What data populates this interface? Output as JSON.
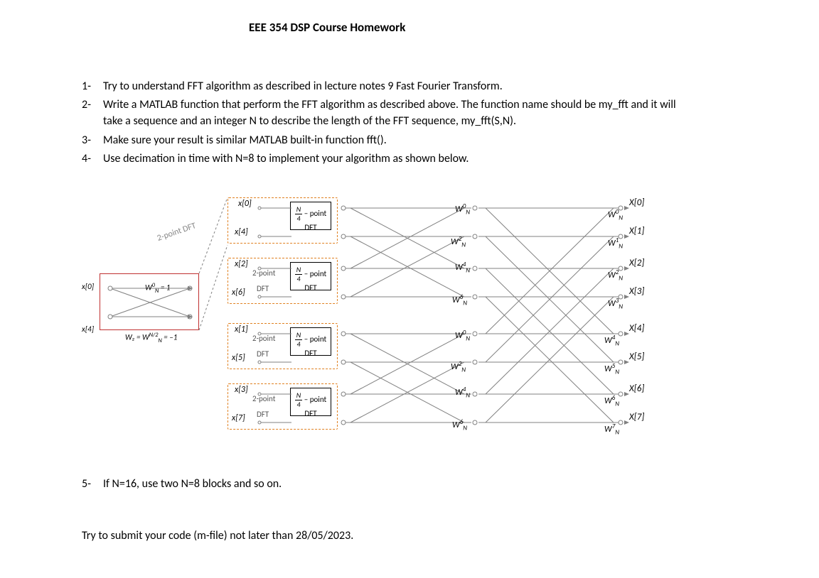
{
  "title": "EEE 354 DSP Course Homework",
  "items": {
    "n1": "1-",
    "t1": "Try to understand FFT algorithm as described in lecture notes 9 Fast Fourier Transform.",
    "n2": "2-",
    "t2": "Write a MATLAB function that perform the FFT algorithm as described above. The function name should be my_fft and it will take a sequence and an integer N to describe the length of the FFT sequence, my_fft(S,N).",
    "n3": "3-",
    "t3": "Make sure your result is similar MATLAB built-in function fft().",
    "n4": "4-",
    "t4": "Use decimation in time with N=8 to implement your algorithm as shown below.",
    "n5": "5-",
    "t5": "If N=16, use two N=8 blocks and so on."
  },
  "footer": "Try to submit your code (m-file) not later than 28/05/2023.",
  "diagram": {
    "zoom_label": "2-point DFT",
    "npoint_top": "– point",
    "npoint_bot": "DFT",
    "grp2pt": "2-point",
    "grpDFT": "DFT",
    "inputs": {
      "x0": "x[0]",
      "x4": "x[4]",
      "x2": "x[2]",
      "x6": "x[6]",
      "x1": "x[1]",
      "x5": "x[5]",
      "x3": "x[3]",
      "x7": "x[7]"
    },
    "zoom_in": {
      "a": "x[0]",
      "b": "x[4]"
    },
    "zoom_w": {
      "w0": "W",
      "w0_sup": "0",
      "w0_sub": "N",
      "w0_eq": "= 1",
      "w1_pre": "W₂ = W",
      "w1_sup": "N/2",
      "w1_sub": "N",
      "w1_eq": "= –1"
    },
    "mid_w": {
      "w0": "W",
      "w2": "W",
      "w4": "W",
      "w6": "W",
      "w0b": "W",
      "w2b": "W",
      "w4b": "W",
      "w6b": "W"
    },
    "mid_sup": {
      "a": "0",
      "b": "2",
      "c": "4",
      "d": "6",
      "e": "0",
      "f": "2",
      "g": "4",
      "h": "6"
    },
    "mid_sub": "N",
    "out_w_sup": {
      "a": "0",
      "b": "1",
      "c": "2",
      "d": "3",
      "e": "4",
      "f": "5",
      "g": "6",
      "h": "7"
    },
    "outputs": {
      "X0": "X[0]",
      "X1": "X[1]",
      "X2": "X[2]",
      "X3": "X[3]",
      "X4": "X[4]",
      "X5": "X[5]",
      "X6": "X[6]",
      "X7": "X[7]"
    }
  }
}
